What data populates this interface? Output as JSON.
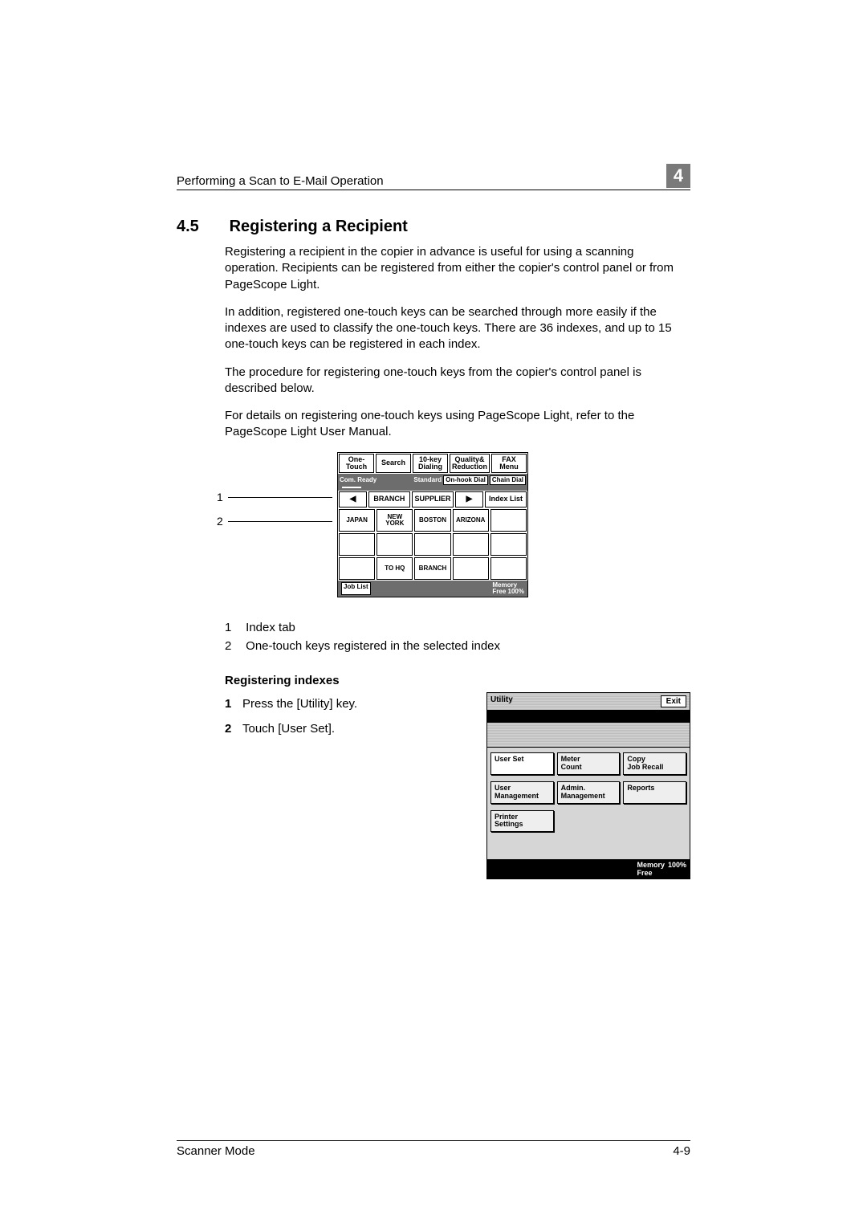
{
  "header": {
    "running": "Performing a Scan to E-Mail Operation",
    "chapter": "4"
  },
  "section": {
    "number": "4.5",
    "title": "Registering a Recipient",
    "paragraphs": [
      "Registering a recipient in the copier in advance is useful for using a scanning operation. Recipients can be registered from either the copier's control panel or from PageScope Light.",
      "In addition, registered one-touch keys can be searched through more easily if the indexes are used to classify the one-touch keys. There are 36 indexes, and up to 15 one-touch keys can be registered in each index.",
      "The procedure for registering one-touch keys from the copier's control panel is described below.",
      "For details on registering one-touch keys using PageScope Light, refer to the PageScope Light User Manual."
    ]
  },
  "fax_panel": {
    "tabs": [
      "One-Touch",
      "Search",
      "10-key\nDialing",
      "Quality&\nReduction",
      "FAX Menu"
    ],
    "status_left": "Com. Ready",
    "status_mid": "Standard",
    "status_btns": [
      "On-hook Dial",
      "Chain Dial"
    ],
    "index_row": [
      "BRANCH",
      "SUPPLIER",
      "Index List"
    ],
    "grid_row1": [
      "JAPAN",
      "NEW YORK",
      "BOSTON",
      "ARIZONA",
      ""
    ],
    "grid_row2": [
      "",
      "",
      "",
      "",
      ""
    ],
    "grid_row3": [
      "",
      "TO HQ",
      "BRANCH",
      "",
      ""
    ],
    "job_list_label": "Job List",
    "memory_label": "Memory\nFree",
    "memory_value": "100%",
    "callouts": {
      "n1": "1",
      "n2": "2"
    }
  },
  "legend": {
    "items": [
      {
        "n": "1",
        "text": "Index tab"
      },
      {
        "n": "2",
        "text": "One-touch keys registered in the selected index"
      }
    ]
  },
  "sub_heading": "Registering indexes",
  "steps": [
    {
      "n": "1",
      "text": "Press the [Utility] key."
    },
    {
      "n": "2",
      "text": "Touch [User Set]."
    }
  ],
  "utility_panel": {
    "title": "Utility",
    "exit": "Exit",
    "rows": [
      [
        "User Set",
        "Meter\nCount",
        "Copy\nJob Recall"
      ],
      [
        "User\nManagement",
        "Admin.\nManagement",
        "Reports"
      ],
      [
        "Printer\nSettings",
        "",
        ""
      ]
    ],
    "memory_label": "Memory\nFree",
    "memory_value": "100%"
  },
  "footer": {
    "left": "Scanner Mode",
    "right": "4-9"
  }
}
